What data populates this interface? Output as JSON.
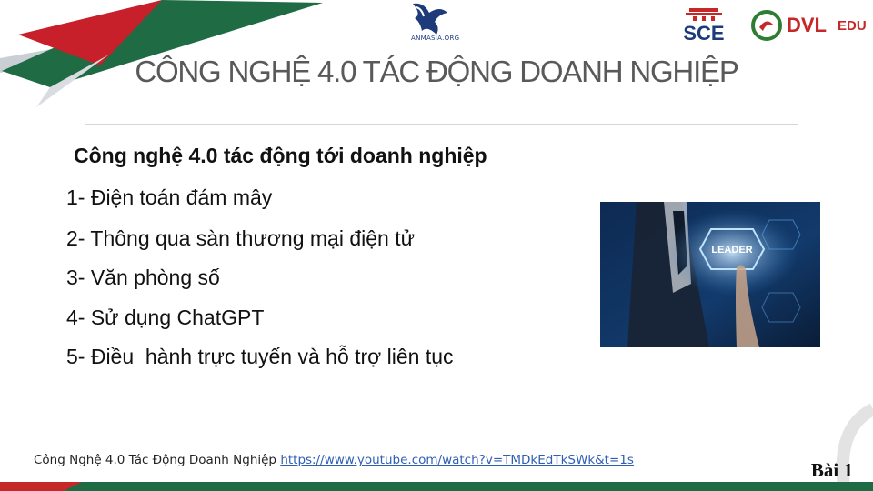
{
  "header": {
    "logos": {
      "center_text": "ANMASIA.ORG",
      "sce": "SCE",
      "dvl": "DVL",
      "edu": "EDU"
    },
    "title": "CÔNG NGHỆ 4.0 TÁC ĐỘNG DOANH NGHIỆP"
  },
  "content": {
    "subtitle": "Công nghệ 4.0 tác động tới doanh nghiệp",
    "items": [
      "1- Điện toán đám mây",
      "2- Thông qua sàn thương mại điện tử",
      "3- Văn phòng số",
      "4- Sử dụng ChatGPT",
      "5- Điều  hành trực tuyến và hỗ trợ liên tục"
    ],
    "image": {
      "label": "LEADER"
    }
  },
  "footer": {
    "text": "Công Nghệ 4.0 Tác Động Doanh Nghiệp",
    "link": "https://www.youtube.com/watch?v=TMDkEdTkSWk&t=1s",
    "page_label": "Bài 1"
  },
  "colors": {
    "green": "#1f6b43",
    "red": "#c62828",
    "title_gray": "#595959",
    "link_blue": "#2f5fb3"
  },
  "icons": [
    "eagle-logo-icon",
    "sce-logo-icon",
    "dvl-edu-logo-icon"
  ]
}
